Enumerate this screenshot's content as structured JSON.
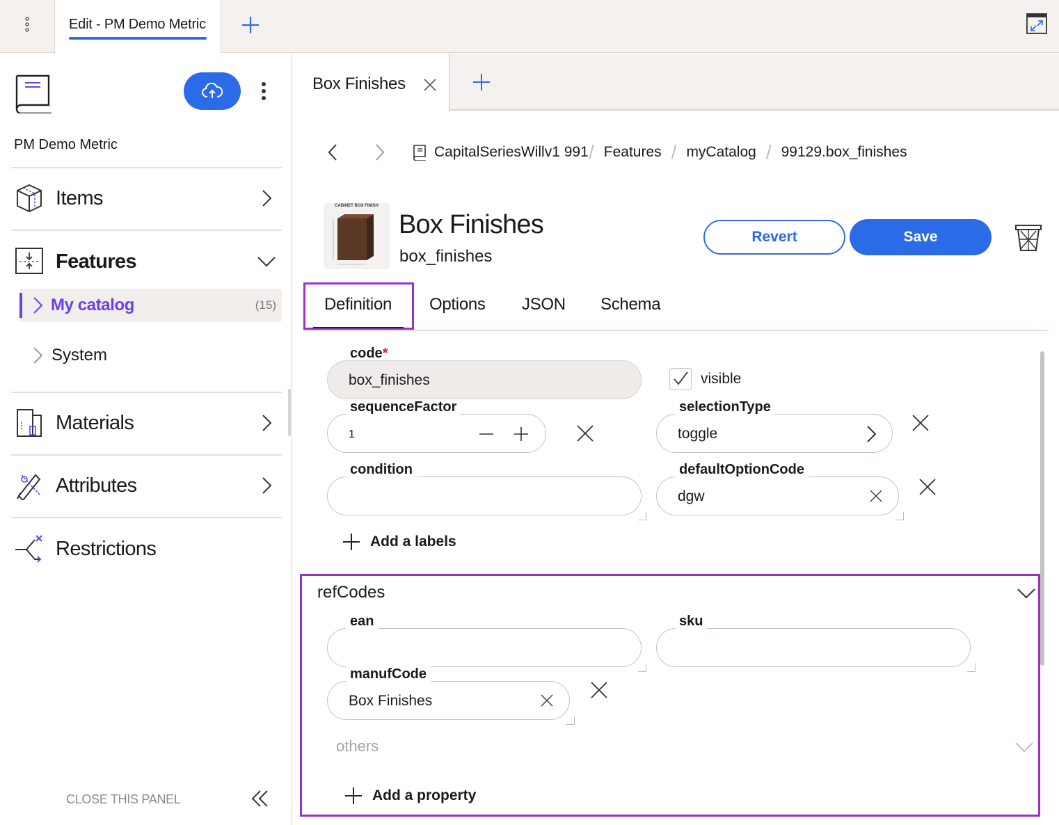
{
  "topbar": {
    "active_tab": "Edit - PM Demo Metric",
    "menu_icon": "vertical-dots-icon",
    "add_icon": "plus-icon",
    "expand_icon": "expand-window-icon"
  },
  "sidebar": {
    "project_name": "PM Demo Metric",
    "nav": {
      "items": "Items",
      "features": "Features",
      "materials": "Materials",
      "attributes": "Attributes",
      "restrictions": "Restrictions"
    },
    "sub": {
      "my_catalog": "My catalog",
      "my_catalog_count": "(15)",
      "system": "System"
    },
    "close_panel": "CLOSE THIS PANEL"
  },
  "main_tab": {
    "label": "Box Finishes"
  },
  "breadcrumb": {
    "catalog": "CapitalSeriesWillv1 991:",
    "features": "Features",
    "my_catalog": "myCatalog",
    "current": "99129.box_finishes"
  },
  "header": {
    "thumb_caption": "CABINET BOX FINISH",
    "title": "Box Finishes",
    "code": "box_finishes",
    "revert": "Revert",
    "save": "Save"
  },
  "def_tabs": [
    "Definition",
    "Options",
    "JSON",
    "Schema"
  ],
  "form": {
    "code_label": "code",
    "code_req": "*",
    "code_value": "box_finishes",
    "visible_label": "visible",
    "visible_checked": true,
    "sequence_label": "sequenceFactor",
    "sequence_value": "1",
    "selection_label": "selectionType",
    "selection_value": "toggle",
    "condition_label": "condition",
    "condition_value": "",
    "default_label": "defaultOptionCode",
    "default_value": "dgw",
    "add_labels": "Add a labels"
  },
  "refcodes": {
    "title": "refCodes",
    "ean_label": "ean",
    "sku_label": "sku",
    "manuf_label": "manufCode",
    "manuf_value": "Box Finishes",
    "others": "others",
    "add_property": "Add a property"
  },
  "colors": {
    "accent": "#2c6be8",
    "highlight": "#9b2fd4",
    "active_nav": "#6d3fe6",
    "required": "#d2262a"
  }
}
